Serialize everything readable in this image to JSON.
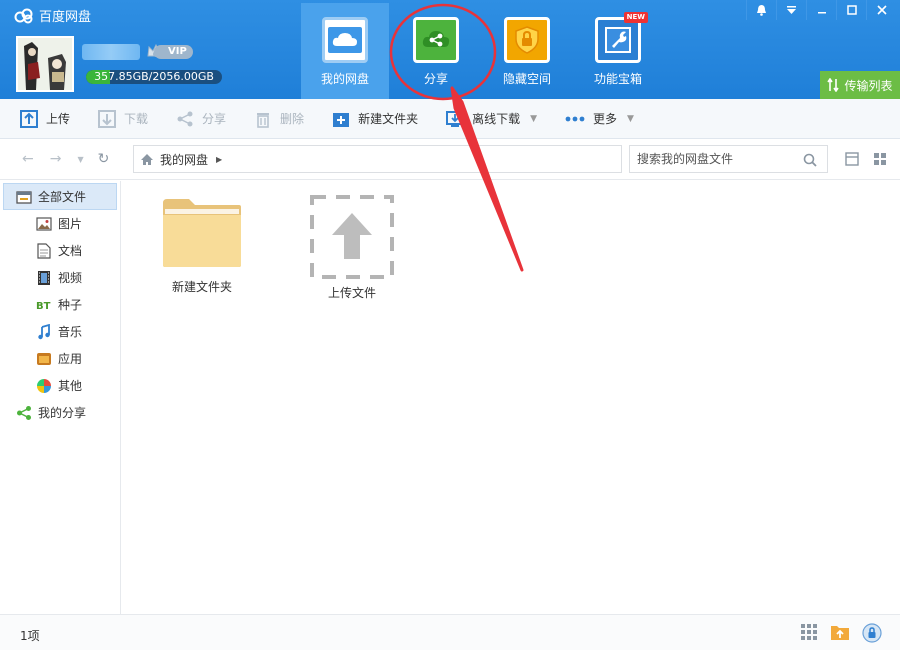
{
  "app": {
    "title": "百度网盘"
  },
  "account": {
    "vip_label": "VIP",
    "quota_text": "357.85GB/2056.00GB",
    "quota_used_gb": 357.85,
    "quota_total_gb": 2056.0
  },
  "nav": {
    "tabs": [
      {
        "label": "我的网盘",
        "icon": "cloud-icon",
        "active": true
      },
      {
        "label": "分享",
        "icon": "share-icon",
        "active": false
      },
      {
        "label": "隐藏空间",
        "icon": "lock-icon",
        "active": false
      },
      {
        "label": "功能宝箱",
        "icon": "wrench-icon",
        "active": false,
        "badge": "NEW"
      }
    ],
    "transfer_label": "传输列表"
  },
  "toolbar": {
    "upload": "上传",
    "download": "下载",
    "share": "分享",
    "delete": "删除",
    "new_folder": "新建文件夹",
    "offline_download": "离线下载",
    "more": "更多"
  },
  "address": {
    "root": "我的网盘",
    "search_placeholder": "搜索我的网盘文件"
  },
  "sidebar": {
    "items": [
      {
        "label": "全部文件",
        "icon": "all-files-icon"
      },
      {
        "label": "图片",
        "icon": "picture-icon"
      },
      {
        "label": "文档",
        "icon": "document-icon"
      },
      {
        "label": "视频",
        "icon": "video-icon"
      },
      {
        "label": "种子",
        "icon": "bt-icon"
      },
      {
        "label": "音乐",
        "icon": "music-icon"
      },
      {
        "label": "应用",
        "icon": "app-icon"
      },
      {
        "label": "其他",
        "icon": "other-icon"
      },
      {
        "label": "我的分享",
        "icon": "share-icon"
      }
    ]
  },
  "content": {
    "items": [
      {
        "label": "新建文件夹",
        "icon": "folder-icon"
      },
      {
        "label": "上传文件",
        "icon": "upload-placeholder-icon"
      }
    ]
  },
  "status": {
    "count": "1项"
  },
  "colors": {
    "header": "#2485dd",
    "accent_green": "#4db33d",
    "annotation_red": "#e8333a"
  }
}
